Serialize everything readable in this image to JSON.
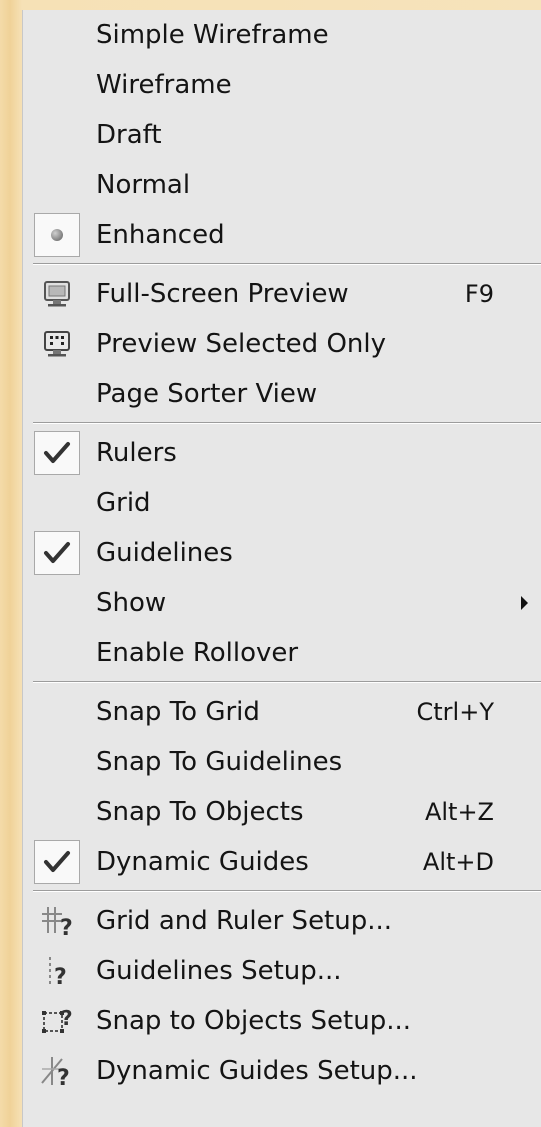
{
  "menu": {
    "view_modes": [
      {
        "label": "Simple Wireframe"
      },
      {
        "label": "Wireframe"
      },
      {
        "label": "Draft"
      },
      {
        "label": "Normal"
      },
      {
        "label": "Enhanced",
        "selected": true
      }
    ],
    "preview": [
      {
        "label": "Full-Screen Preview",
        "shortcut": "F9",
        "icon": "full-screen-preview-icon"
      },
      {
        "label": "Preview Selected Only",
        "icon": "preview-selected-icon"
      },
      {
        "label": "Page Sorter View"
      }
    ],
    "show": [
      {
        "label": "Rulers",
        "checked": true
      },
      {
        "label": "Grid",
        "checked": false
      },
      {
        "label": "Guidelines",
        "checked": true
      },
      {
        "label": "Show",
        "submenu": true
      },
      {
        "label": "Enable Rollover",
        "checked": false
      }
    ],
    "snap": [
      {
        "label": "Snap To Grid",
        "shortcut": "Ctrl+Y"
      },
      {
        "label": "Snap To Guidelines",
        "shortcut": ""
      },
      {
        "label": "Snap To Objects",
        "shortcut": "Alt+Z"
      },
      {
        "label": "Dynamic Guides",
        "shortcut": "Alt+D",
        "checked": true
      }
    ],
    "setup": [
      {
        "label": "Grid and Ruler Setup...",
        "icon": "grid-ruler-setup-icon"
      },
      {
        "label": "Guidelines Setup...",
        "icon": "guidelines-setup-icon"
      },
      {
        "label": "Snap to Objects Setup...",
        "icon": "snap-objects-setup-icon"
      },
      {
        "label": "Dynamic Guides Setup...",
        "icon": "dynamic-guides-setup-icon"
      }
    ]
  }
}
